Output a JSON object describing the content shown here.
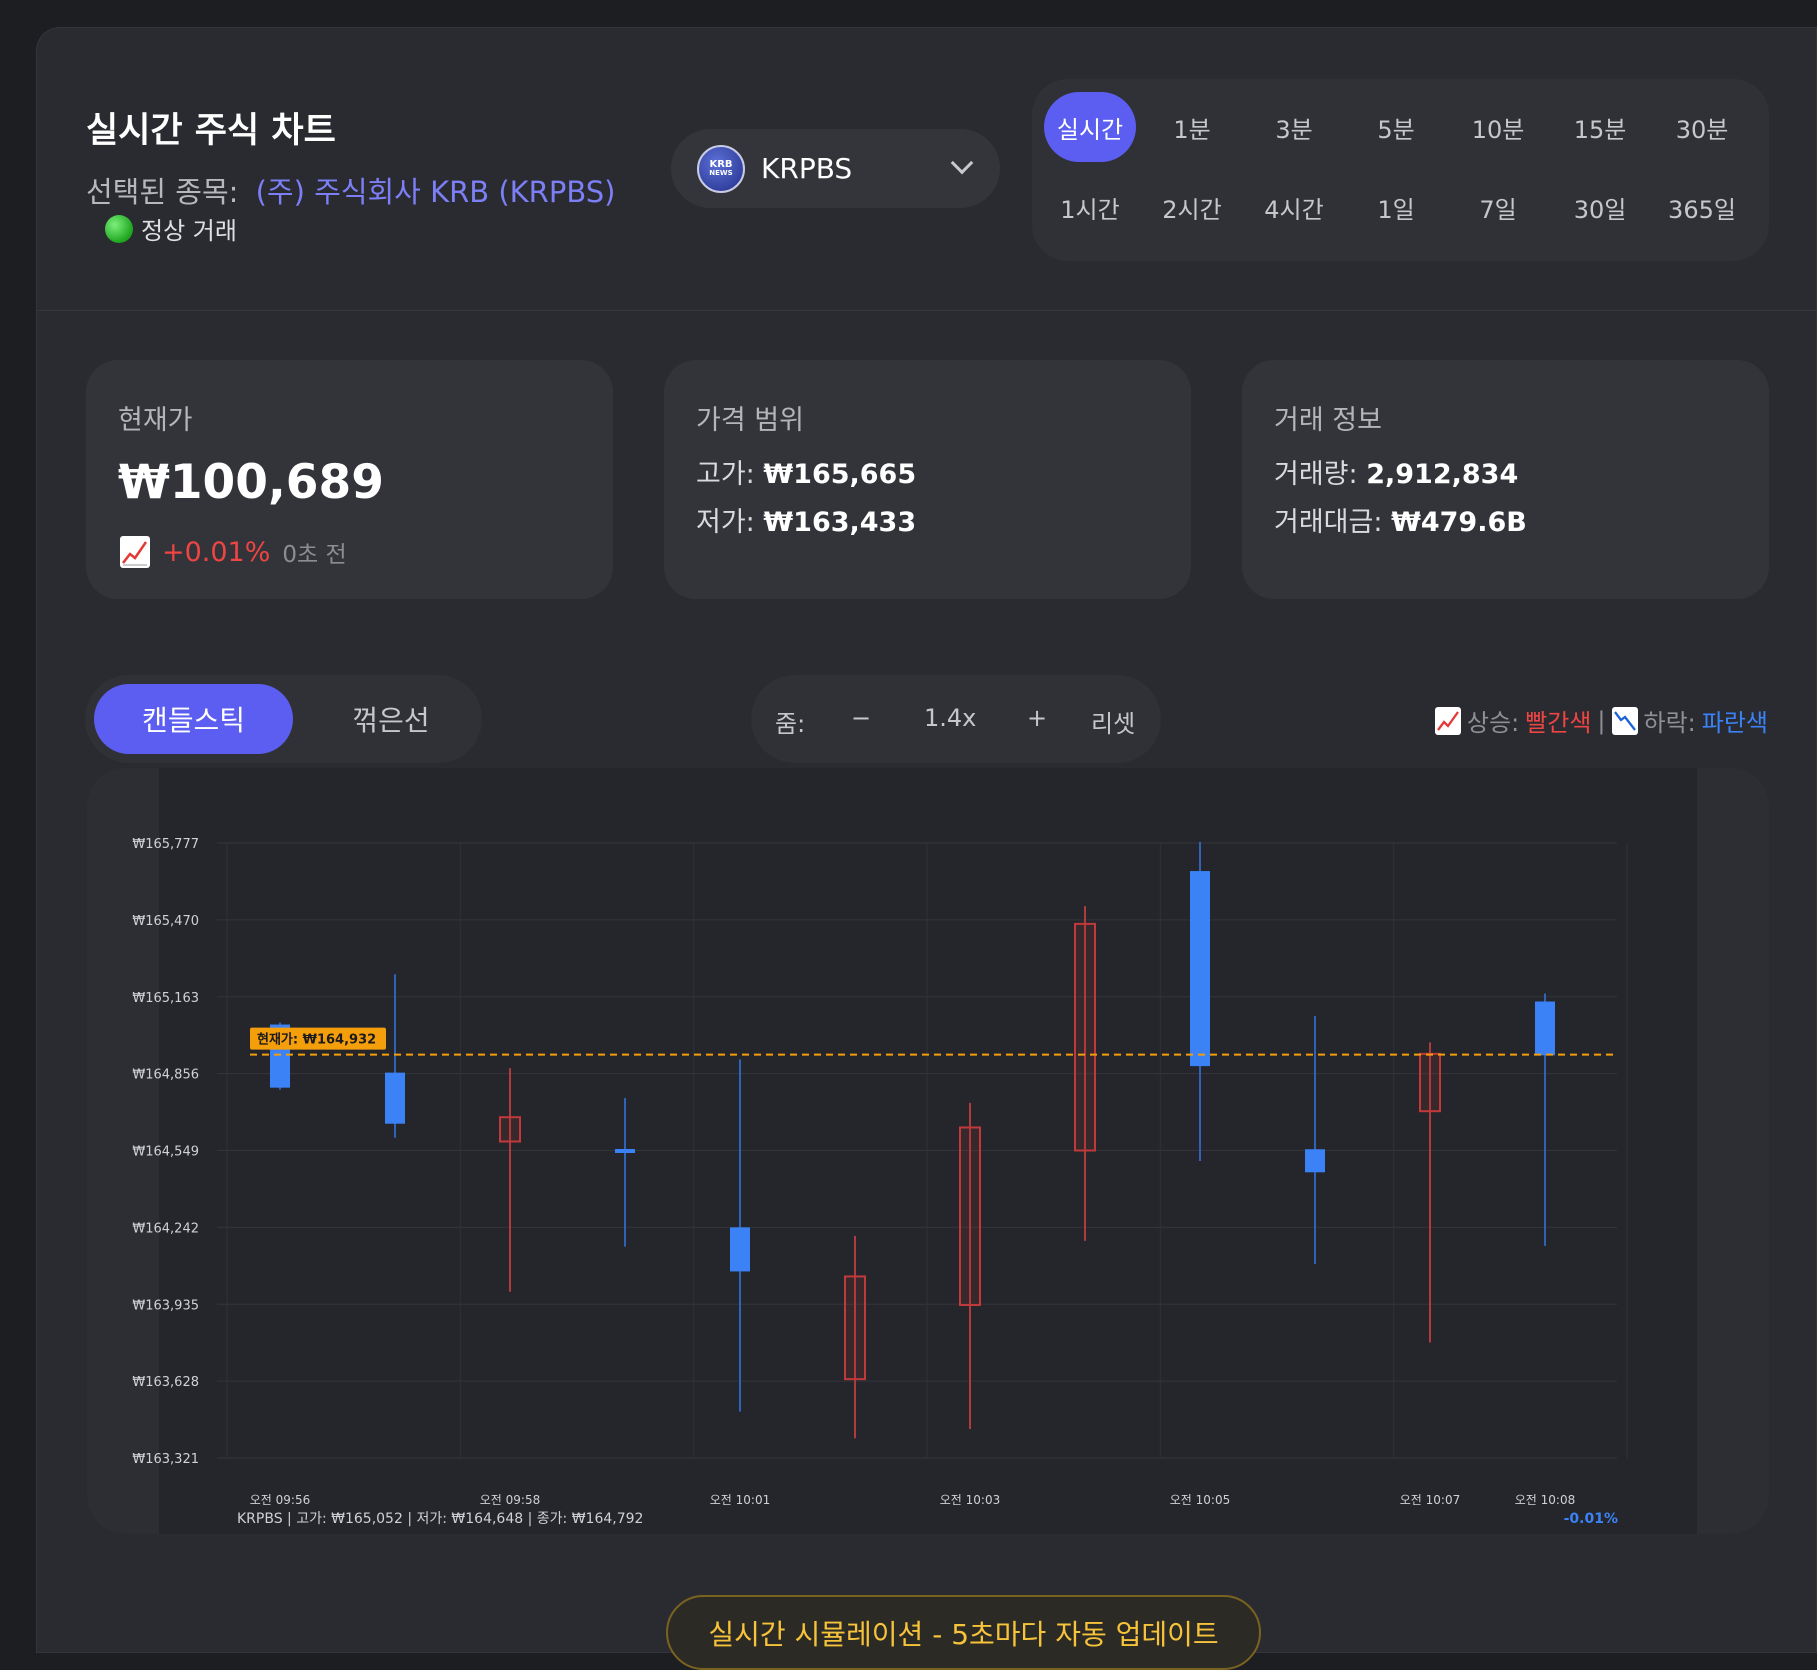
{
  "header": {
    "title": "실시간 주식 차트",
    "selected_label": "선택된 종목:",
    "selected_stock": "(주) 주식회사 KRB (KRPBS)",
    "status": "정상 거래",
    "ticker": {
      "logo_top": "KRB",
      "logo_bottom": "NEWS",
      "symbol": "KRPBS"
    }
  },
  "intervals": {
    "active": "실시간",
    "row1": [
      "실시간",
      "1분",
      "3분",
      "5분",
      "10분",
      "15분",
      "30분"
    ],
    "row2": [
      "1시간",
      "2시간",
      "4시간",
      "1일",
      "7일",
      "30일",
      "365일"
    ]
  },
  "cards": {
    "current": {
      "title": "현재가",
      "price": "₩100,689",
      "change": "+0.01%",
      "time": "0초 전"
    },
    "range": {
      "title": "가격 범위",
      "high_label": "고가:",
      "high": "₩165,665",
      "low_label": "저가:",
      "low": "₩163,433"
    },
    "trade": {
      "title": "거래 정보",
      "volume_label": "거래량:",
      "volume": "2,912,834",
      "amount_label": "거래대금:",
      "amount": "₩479.6B"
    }
  },
  "controls": {
    "chart_types": [
      "캔들스틱",
      "꺾은선"
    ],
    "active_type": "캔들스틱",
    "zoom_label": "줌:",
    "zoom_minus": "−",
    "zoom_value": "1.4x",
    "zoom_plus": "+",
    "reset": "리셋",
    "legend": {
      "up_label": "상승:",
      "up_value": "빨간색",
      "sep": "|",
      "down_label": "하락:",
      "down_value": "파란색"
    }
  },
  "colors": {
    "up": "#ef4444",
    "down": "#3b82f6",
    "accent": "#5b5ef0",
    "current_line": "#f59e0b"
  },
  "chart_data": {
    "type": "candlestick",
    "y_ticks": [
      "₩165,777",
      "₩165,470",
      "₩165,163",
      "₩164,856",
      "₩164,549",
      "₩164,242",
      "₩163,935",
      "₩163,628",
      "₩163,321"
    ],
    "ylim": [
      163321,
      165777
    ],
    "x_tick_labels": [
      {
        "index": 0,
        "label": "오전 09:56"
      },
      {
        "index": 2,
        "label": "오전 09:58"
      },
      {
        "index": 4,
        "label": "오전 10:01"
      },
      {
        "index": 6,
        "label": "오전 10:03"
      },
      {
        "index": 8,
        "label": "오전 10:05"
      },
      {
        "index": 10,
        "label": "오전 10:07"
      },
      {
        "index": 11,
        "label": "오전 10:08"
      }
    ],
    "candles": [
      {
        "open": 165052,
        "high": 165060,
        "low": 164792,
        "close": 164800
      },
      {
        "open": 164860,
        "high": 165253,
        "low": 164600,
        "close": 164656
      },
      {
        "open": 164585,
        "high": 164878,
        "low": 163985,
        "close": 164682
      },
      {
        "open": 164555,
        "high": 164759,
        "low": 164165,
        "close": 164541
      },
      {
        "open": 164242,
        "high": 164913,
        "low": 163506,
        "close": 164066
      },
      {
        "open": 163636,
        "high": 164208,
        "low": 163400,
        "close": 164046
      },
      {
        "open": 163932,
        "high": 164739,
        "low": 163437,
        "close": 164641
      },
      {
        "open": 164549,
        "high": 165525,
        "low": 164188,
        "close": 165454
      },
      {
        "open": 165665,
        "high": 165782,
        "low": 164507,
        "close": 164886
      },
      {
        "open": 164554,
        "high": 165086,
        "low": 164096,
        "close": 164462
      },
      {
        "open": 164706,
        "high": 164981,
        "low": 163782,
        "close": 164935
      },
      {
        "open": 165144,
        "high": 165176,
        "low": 164168,
        "close": 164929
      }
    ],
    "current_price": 164932,
    "current_label": "현재가: ₩164,932",
    "footer_info": "KRPBS | 고가: ₩165,052 | 저가: ₩164,648 | 종가: ₩164,792",
    "footer_change": "-0.01%"
  },
  "banner": "실시간 시뮬레이션 - 5초마다 자동 업데이트"
}
